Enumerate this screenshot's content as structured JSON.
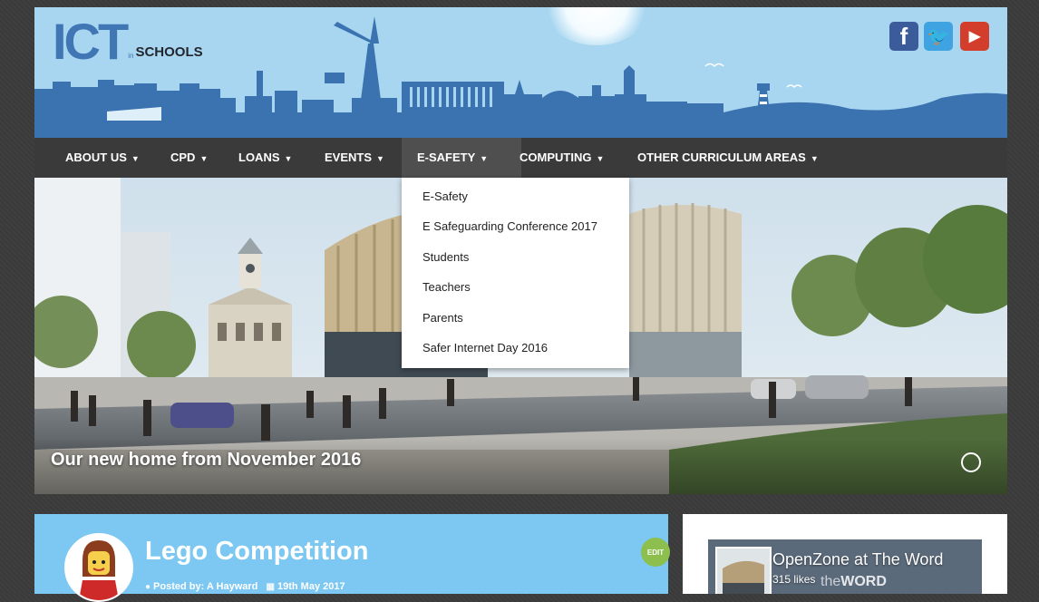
{
  "header": {
    "logo": {
      "main": "ICT",
      "in": "in",
      "schools": "SCHOOLS"
    },
    "social": [
      {
        "icon": "facebook-icon",
        "glyph": "f"
      },
      {
        "icon": "twitter-icon",
        "glyph": "🐦"
      },
      {
        "icon": "youtube-icon",
        "glyph": "▶"
      }
    ]
  },
  "nav": {
    "items": [
      {
        "label": "ABOUT US"
      },
      {
        "label": "CPD"
      },
      {
        "label": "LOANS"
      },
      {
        "label": "EVENTS"
      },
      {
        "label": "E-SAFETY",
        "active": true
      },
      {
        "label": "COMPUTING"
      },
      {
        "label": "OTHER CURRICULUM AREAS"
      }
    ],
    "caret": "▼"
  },
  "dropdown": {
    "items": [
      "E-Safety",
      "E Safeguarding Conference 2017",
      "Students",
      "Teachers",
      "Parents",
      "Safer Internet Day 2016"
    ]
  },
  "hero": {
    "caption": "Our new home from November 2016"
  },
  "post": {
    "title": "Lego Competition",
    "posted_by": "Posted by: A Hayward",
    "date": "19th May 2017",
    "edit_label": "EDIT"
  },
  "sidebar": {
    "fb_page_name": "OpenZone at The Word",
    "fb_likes": "315 likes",
    "fb_word_prefix": "the",
    "fb_word": "WORD"
  },
  "colors": {
    "header_sky": "#a8d6f0",
    "skyline": "#3a73b0",
    "nav_bg": "#3a3a3a",
    "post_bg": "#7cc8f2",
    "edit_badge": "#8dbf4f"
  }
}
